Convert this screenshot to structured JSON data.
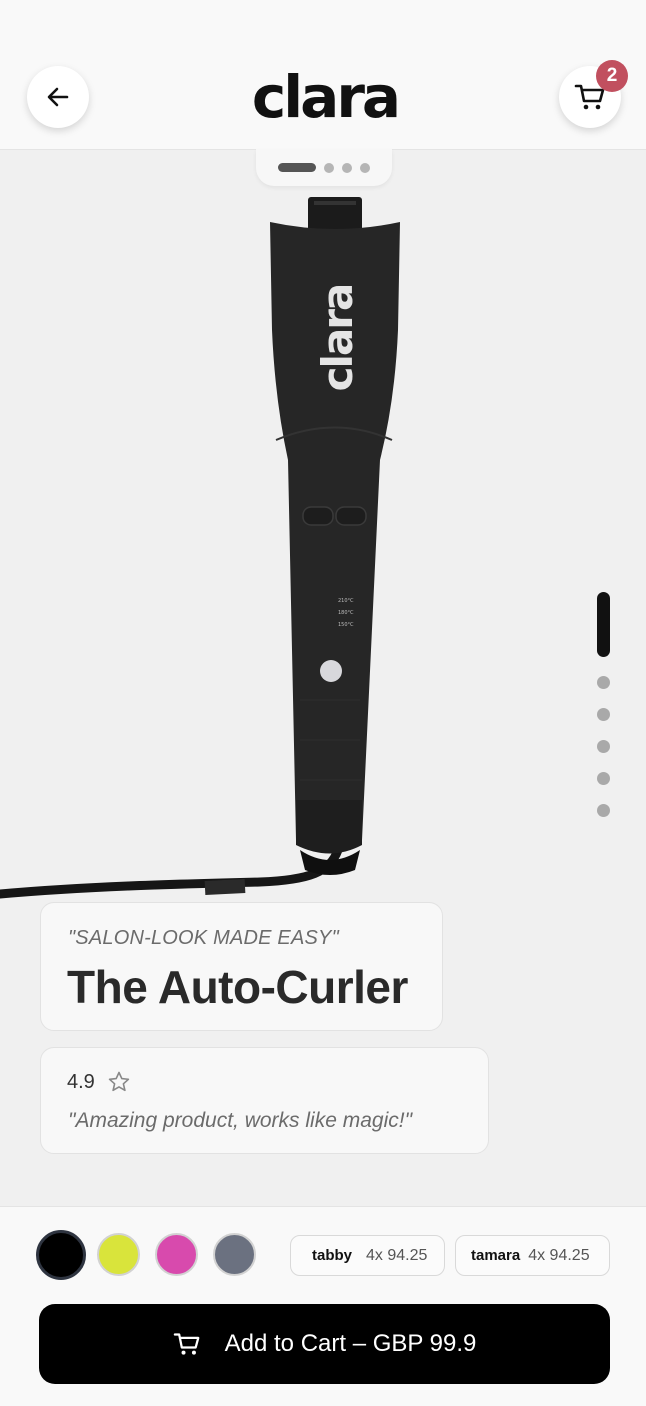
{
  "header": {
    "brand": "clara",
    "back_icon": "arrow-left-icon",
    "cart_icon": "cart-icon",
    "cart_count": "2"
  },
  "gallery": {
    "image_count": 4,
    "active_image": 1,
    "product_logo_text": "clara",
    "temperature_labels": [
      "210°C",
      "180°C",
      "150°C"
    ]
  },
  "vertical_pager": {
    "count": 6,
    "active": 1
  },
  "product": {
    "tagline": "\"SALON-LOOK MADE EASY\"",
    "title": "The Auto-Curler"
  },
  "review": {
    "rating": "4.9",
    "star_icon": "star-outline-icon",
    "quote": "\"Amazing product, works like magic!\""
  },
  "colors": {
    "options": [
      "#000000",
      "#d9e43b",
      "#d84aad",
      "#6b7180"
    ],
    "selected": "#000000"
  },
  "payments": [
    {
      "brand": "tabby",
      "installment": "4x 94.25"
    },
    {
      "brand": "tamara",
      "installment": "4x 94.25"
    }
  ],
  "cta": {
    "label": "Add to Cart – GBP 99.9",
    "icon": "cart-icon"
  },
  "accent": {
    "badge": "#c1505f",
    "button": "#000000"
  }
}
